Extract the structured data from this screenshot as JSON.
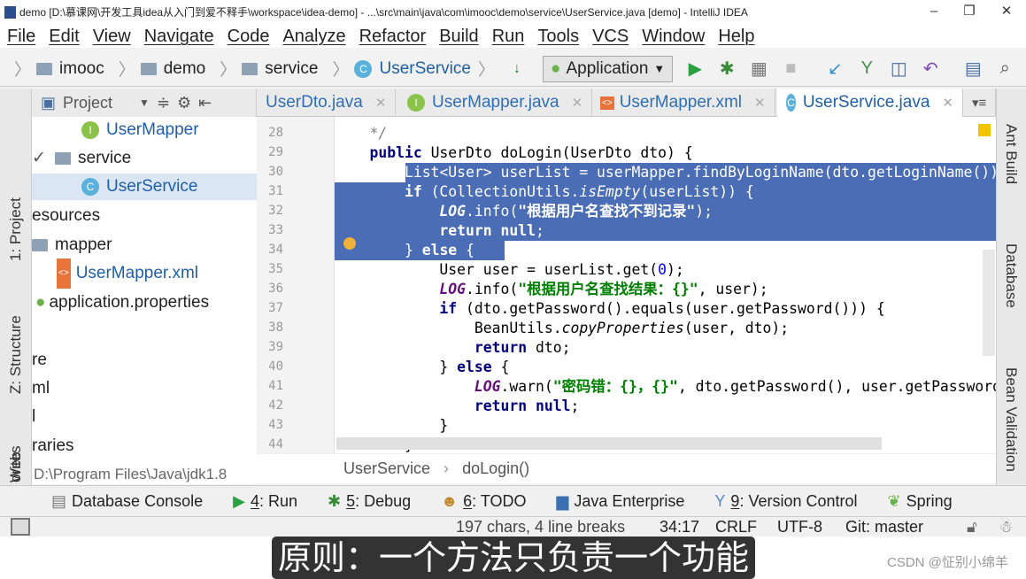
{
  "window": {
    "title": "demo [D:\\慕课网\\开发工具idea从入门到爱不释手\\workspace\\idea-demo] - ...\\src\\main\\java\\com\\imooc\\demo\\service\\UserService.java [demo] - IntelliJ IDEA",
    "minimize": "–",
    "restore": "❐",
    "close": "✕"
  },
  "menu": [
    "File",
    "Edit",
    "View",
    "Navigate",
    "Code",
    "Analyze",
    "Refactor",
    "Build",
    "Run",
    "Tools",
    "VCS",
    "Window",
    "Help"
  ],
  "nav": {
    "crumbs": [
      "imooc",
      "demo",
      "service",
      "UserService"
    ],
    "run_config": "Application"
  },
  "project_tool": {
    "label": "Project"
  },
  "tabs": [
    {
      "label": "UserDto.java"
    },
    {
      "label": "UserMapper.java"
    },
    {
      "label": "UserMapper.xml"
    },
    {
      "label": "UserService.java"
    }
  ],
  "left_stripe": [
    "1: Project",
    "Z: Structure",
    "Web",
    "orites"
  ],
  "right_stripe": [
    "Ant Build",
    "Database",
    "Bean Validation"
  ],
  "tree": [
    "UserMapper",
    "service",
    "UserService",
    "esources",
    "mapper",
    "UserMapper.xml",
    "application.properties",
    "re",
    "ml",
    "l",
    "raries"
  ],
  "sdk": "D:\\Program Files\\Java\\jdk1.8",
  "code": {
    "line_numbers": [
      "28",
      "29",
      "30",
      "31",
      "32",
      "33",
      "34",
      "35",
      "36",
      "37",
      "38",
      "39",
      "40",
      "41",
      "42",
      "43",
      "44"
    ],
    "l28": "    */",
    "l29a": "public ",
    "l29b": "UserDto doLogin(UserDto dto) {",
    "l30": "List<User> userList = userMapper.findByLoginName(dto.getLoginName());",
    "l31a": "if ",
    "l31b": "(CollectionUtils.",
    "l31c": "isEmpty",
    "l31d": "(userList)) {",
    "l32a": "LOG",
    ".": ".",
    "l32b": "info(",
    "l32c": "\"根据用户名查找不到记录\"",
    "l32d": ");",
    "l33a": "return null",
    ";": ";",
    "l34a": "} ",
    "l34b": "else ",
    "l34c": "{",
    "l35a": "User user = userList.get(",
    "l35b": "0",
    "l35c": ");",
    "l36a": "LOG",
    "l36b": ".info(",
    "l36c": "\"根据用户名查找结果：{}\"",
    "l36d": ", user);",
    "l37a": "if ",
    "l37b": "(dto.getPassword().equals(user.getPassword())) {",
    "l38a": "BeanUtils.",
    "l38b": "copyProperties",
    "l38c": "(user, dto);",
    "l39a": "return ",
    "l39b": "dto;",
    "l40a": "} ",
    "l40b": "else ",
    "l40c": "{",
    "l41a": "LOG",
    "l41b": ".warn(",
    "l41c": "\"密码错：{}，{}\"",
    "l41d": ", dto.getPassword(), user.getPassword());",
    "l42a": "return null",
    "l42b": ";",
    "l43": "}",
    "l44": "}"
  },
  "editor_breadcrumb": [
    "UserService",
    "doLogin()"
  ],
  "toolwindows": [
    {
      "label": "Database Console"
    },
    {
      "num": "4",
      "label": ": Run"
    },
    {
      "num": "5",
      "label": ": Debug"
    },
    {
      "num": "6",
      "label": ": TODO"
    },
    {
      "label": "Java Enterprise"
    },
    {
      "num": "9",
      "label": ": Version Control"
    },
    {
      "label": "Spring"
    }
  ],
  "status": {
    "selection": "197 chars, 4 line breaks",
    "position": "34:17",
    "line_sep": "CRLF",
    "encoding": "UTF-8",
    "git": "Git: master"
  },
  "subtitle": "原则：一个方法只负责一个功能",
  "watermark": "CSDN @怔别小绵羊"
}
